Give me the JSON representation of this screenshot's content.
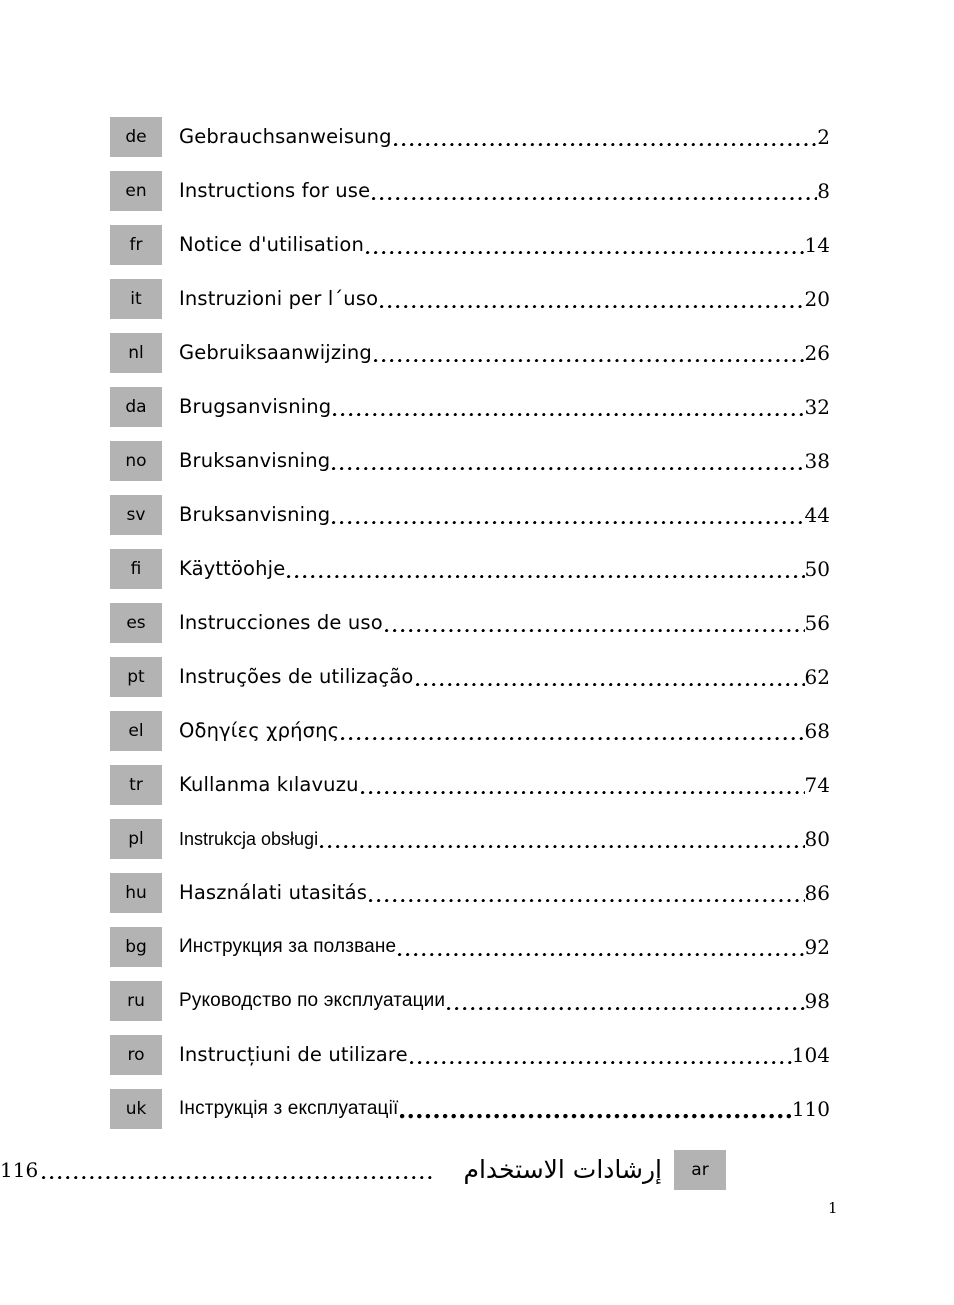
{
  "page": {
    "folio": "1",
    "badge_color": "#b3b3b3"
  },
  "toc": {
    "entries": [
      {
        "lang": "de",
        "title": "Gebrauchsanweisung",
        "page": "2"
      },
      {
        "lang": "en",
        "title": "Instructions for use",
        "page": "8"
      },
      {
        "lang": "fr",
        "title": "Notice d'utilisation",
        "page": "14"
      },
      {
        "lang": "it",
        "title": "Instruzioni per l´uso",
        "page": "20"
      },
      {
        "lang": "nl",
        "title": "Gebruiksaanwijzing",
        "page": "26"
      },
      {
        "lang": "da",
        "title": "Brugsanvisning",
        "page": "32"
      },
      {
        "lang": "no",
        "title": "Bruksanvisning",
        "page": "38"
      },
      {
        "lang": "sv",
        "title": "Bruksanvisning",
        "page": "44"
      },
      {
        "lang": "fi",
        "title": "Käyttöohje",
        "page": "50"
      },
      {
        "lang": "es",
        "title": "Instrucciones de uso",
        "page": "56"
      },
      {
        "lang": "pt",
        "title": "Instruções de utilização",
        "page": "62"
      },
      {
        "lang": "el",
        "title": "Οδηγίες χρήσης",
        "page": "68"
      },
      {
        "lang": "tr",
        "title": "Kullanma kılavuzu",
        "page": "74"
      },
      {
        "lang": "pl",
        "title": "Instrukcja obsługi",
        "page": "80"
      },
      {
        "lang": "hu",
        "title": "Használati utasitás",
        "page": "86"
      },
      {
        "lang": "bg",
        "title": "Инструкция за ползване",
        "page": "92"
      },
      {
        "lang": "ru",
        "title": "Руководство по эксплуатации",
        "page": "98"
      },
      {
        "lang": "ro",
        "title": "Instrucțiuni de utilizare",
        "page": "104"
      },
      {
        "lang": "uk",
        "title": "Інструкція з експлуатації",
        "page": "110"
      }
    ],
    "rtl_entry": {
      "lang": "ar",
      "title": "إرشادات الاستخدام",
      "page": "116"
    }
  }
}
